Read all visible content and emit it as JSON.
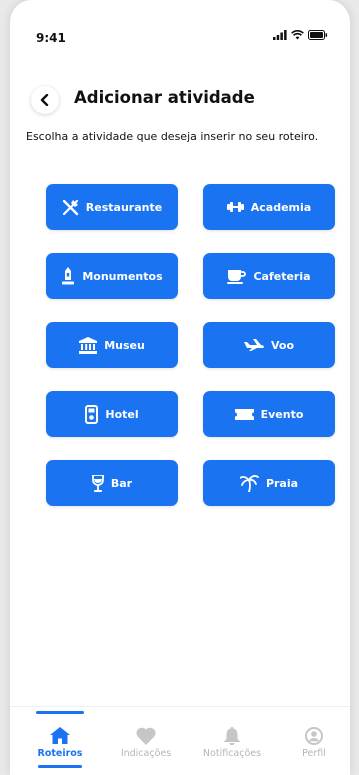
{
  "status": {
    "time": "9:41"
  },
  "header": {
    "title": "Adicionar atividade"
  },
  "subtitle": "Escolha a atividade que deseja inserir no seu roteiro.",
  "activities": [
    {
      "label": "Restaurante",
      "icon": "utensils-icon"
    },
    {
      "label": "Academia",
      "icon": "dumbbell-icon"
    },
    {
      "label": "Monumentos",
      "icon": "monument-icon"
    },
    {
      "label": "Cafeteria",
      "icon": "coffee-cup-icon"
    },
    {
      "label": "Museu",
      "icon": "museum-icon"
    },
    {
      "label": "Voo",
      "icon": "plane-icon"
    },
    {
      "label": "Hotel",
      "icon": "hotel-icon"
    },
    {
      "label": "Evento",
      "icon": "ticket-icon"
    },
    {
      "label": "Bar",
      "icon": "wine-glass-icon"
    },
    {
      "label": "Praia",
      "icon": "palm-tree-icon"
    }
  ],
  "tabs": [
    {
      "label": "Roteiros",
      "icon": "home-icon",
      "active": true
    },
    {
      "label": "Indicações",
      "icon": "heart-icon",
      "active": false
    },
    {
      "label": "Notificações",
      "icon": "bell-icon",
      "active": false
    },
    {
      "label": "Perfil",
      "icon": "user-icon",
      "active": false
    }
  ],
  "colors": {
    "accent": "#1a73f0",
    "inactive": "#b5b5b5",
    "text": "#111111"
  }
}
